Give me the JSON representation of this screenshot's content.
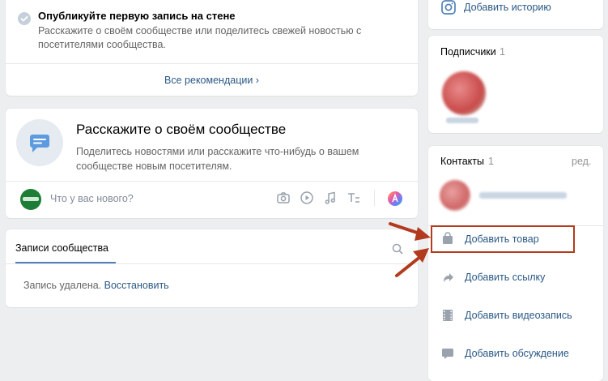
{
  "recommendation": {
    "title": "Опубликуйте первую запись на стене",
    "description": "Расскажите о своём сообществе или поделитесь свежей новостью с посетителями сообщества.",
    "all_link": "Все рекомендации ›"
  },
  "composer_intro": {
    "title": "Расскажите о своём сообществе",
    "description": "Поделитесь новостями или расскажите что-нибудь о вашем сообществе новым посетителям."
  },
  "composer": {
    "placeholder": "Что у вас нового?",
    "tools": [
      "camera-icon",
      "video-icon",
      "music-icon",
      "text-format-icon",
      "color-wheel-icon"
    ]
  },
  "wall": {
    "tab_label": "Записи сообщества",
    "deleted_text": "Запись удалена.",
    "restore_link": "Восстановить"
  },
  "sidebar": {
    "story_label": "Добавить историю",
    "subscribers": {
      "title": "Подписчики",
      "count": "1"
    },
    "contacts": {
      "title": "Контакты",
      "count": "1",
      "edit": "ред."
    },
    "actions": [
      {
        "label": "Добавить товар",
        "icon": "bag-icon"
      },
      {
        "label": "Добавить ссылку",
        "icon": "link-arrow-icon"
      },
      {
        "label": "Добавить видеозапись",
        "icon": "film-icon"
      },
      {
        "label": "Добавить обсуждение",
        "icon": "chat-icon"
      }
    ]
  },
  "colors": {
    "link": "#2a5885",
    "accent": "#5181b8",
    "highlight": "#b23a1f",
    "background": "#edeef0"
  }
}
